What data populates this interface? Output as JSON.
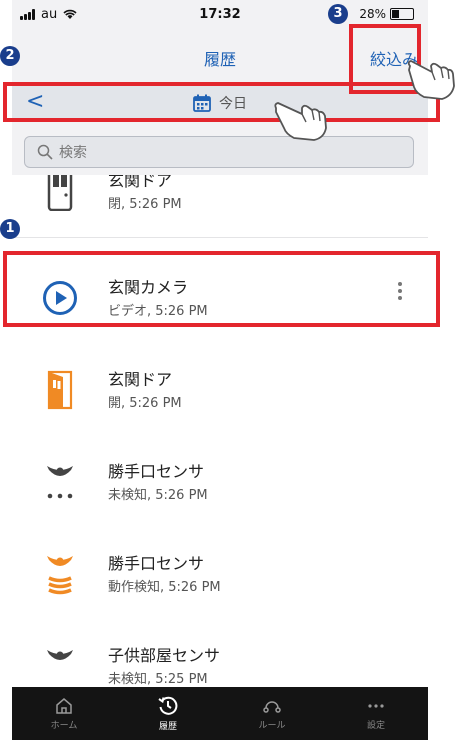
{
  "status": {
    "carrier": "au",
    "time": "17:32",
    "battery": "28%"
  },
  "nav": {
    "title": "履歴",
    "filter_label": "絞込み"
  },
  "date_bar": {
    "back": "<",
    "label": "今日"
  },
  "search": {
    "placeholder": "検索"
  },
  "items": [
    {
      "title": "玄関ドア",
      "subtitle": "閉, 5:26 PM",
      "icon": "door-closed-icon"
    },
    {
      "title": "玄関カメラ",
      "subtitle": "ビデオ, 5:26 PM",
      "icon": "play-camera-icon"
    },
    {
      "title": "玄関ドア",
      "subtitle": "開, 5:26 PM",
      "icon": "door-open-icon"
    },
    {
      "title": "勝手口センサ",
      "subtitle": "未検知, 5:26 PM",
      "icon": "motion-sensor-idle-icon"
    },
    {
      "title": "勝手口センサ",
      "subtitle": "動作検知, 5:26 PM",
      "icon": "motion-sensor-active-icon"
    },
    {
      "title": "子供部屋センサ",
      "subtitle": "未検知, 5:25 PM",
      "icon": "motion-sensor-idle-icon"
    }
  ],
  "tabs": [
    {
      "label": "ホーム",
      "icon": "home-icon"
    },
    {
      "label": "履歴",
      "icon": "history-icon",
      "active": true
    },
    {
      "label": "ルール",
      "icon": "rules-icon"
    },
    {
      "label": "設定",
      "icon": "more-icon"
    }
  ],
  "annotations": {
    "badge1": "1",
    "badge2": "2",
    "badge3": "3"
  },
  "colors": {
    "accent": "#1f62b5",
    "highlight": "#e3262d",
    "orange": "#f08a24",
    "badge": "#1a3e8c"
  }
}
